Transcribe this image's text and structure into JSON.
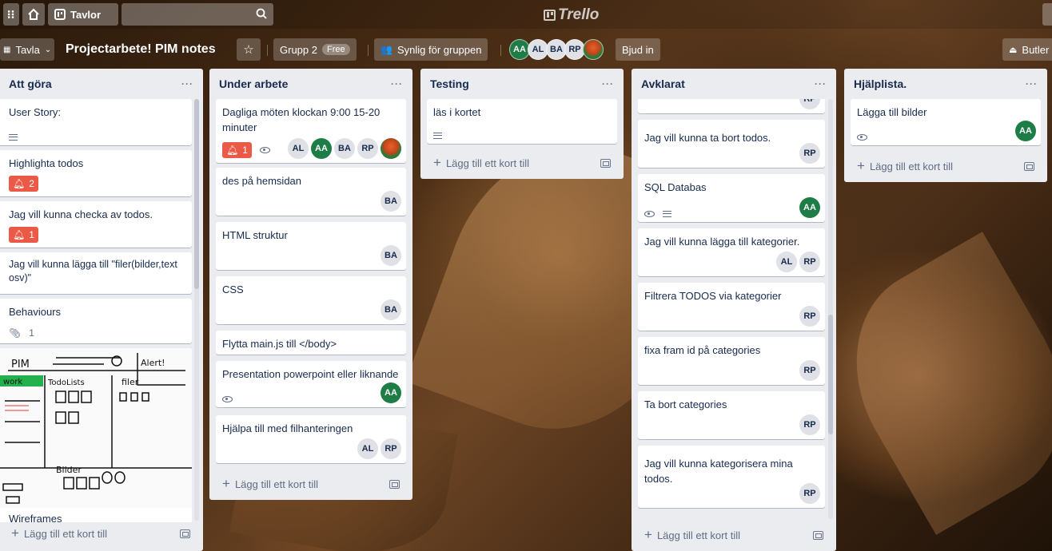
{
  "topbar": {
    "board_button_label": "Tavlor"
  },
  "header": {
    "board_menu_label": "Tavla",
    "board_title": "Projectarbete! PIM notes",
    "team_label": "Grupp 2",
    "team_plan": "Free",
    "visibility_label": "Synlig för gruppen",
    "invite_label": "Bjud in",
    "butler_label": "Butler",
    "members": [
      "AA",
      "AL",
      "BA",
      "RP"
    ]
  },
  "add_card_label": "Lägg till ett kort till",
  "lists": [
    {
      "title": "Att göra",
      "cards": [
        {
          "title": "User Story:"
        },
        {
          "title": "Highlighta todos",
          "notif": "2"
        },
        {
          "title": "Jag vill kunna checka av todos.",
          "notif": "1"
        },
        {
          "title": "Jag vill kunna lägga till \"filer(bilder,text osv)\""
        },
        {
          "title": "Behaviours",
          "attachments": "1"
        },
        {
          "title": "Wireframes"
        }
      ],
      "wireframe": {
        "pim": "PIM",
        "todo": "TodoLists",
        "filer": "filer",
        "alert": "Alert!",
        "work": "work",
        "bilder": "Bilder"
      }
    },
    {
      "title": "Under arbete",
      "cards": [
        {
          "title": "Dagliga möten klockan 9:00 15-20 minuter",
          "notif": "1",
          "members": [
            "AL",
            "AA",
            "BA",
            "RP"
          ]
        },
        {
          "title": "des på hemsidan",
          "members": [
            "BA"
          ]
        },
        {
          "title": "HTML struktur",
          "members": [
            "BA"
          ]
        },
        {
          "title": "CSS",
          "members": [
            "BA"
          ]
        },
        {
          "title": "Flytta main.js till </body>"
        },
        {
          "title": "Presentation powerpoint eller liknande",
          "members": [
            "AA"
          ]
        },
        {
          "title": "Hjälpa till med filhanteringen",
          "members": [
            "AL",
            "RP"
          ]
        }
      ]
    },
    {
      "title": "Testing",
      "cards": [
        {
          "title": "läs i kortet"
        }
      ]
    },
    {
      "title": "Avklarat",
      "cards": [
        {
          "title": "Jag vill kunna ta bort todos.",
          "members": [
            "RP"
          ]
        },
        {
          "title": "SQL Databas",
          "members": [
            "AA"
          ]
        },
        {
          "title": "Jag vill kunna lägga till kategorier.",
          "members": [
            "AL",
            "RP"
          ]
        },
        {
          "title": "Filtrera TODOS via kategorier",
          "members": [
            "RP"
          ]
        },
        {
          "title": "fixa fram id på categories",
          "members": [
            "RP"
          ]
        },
        {
          "title": "Ta bort categories",
          "members": [
            "RP"
          ]
        },
        {
          "title": "Jag vill kunna kategorisera mina todos.",
          "members": [
            "RP"
          ]
        }
      ],
      "partial_member": "RP"
    },
    {
      "title": "Hjälplista.",
      "cards": [
        {
          "title": "Lägga till bilder",
          "members": [
            "AA"
          ]
        }
      ]
    }
  ]
}
